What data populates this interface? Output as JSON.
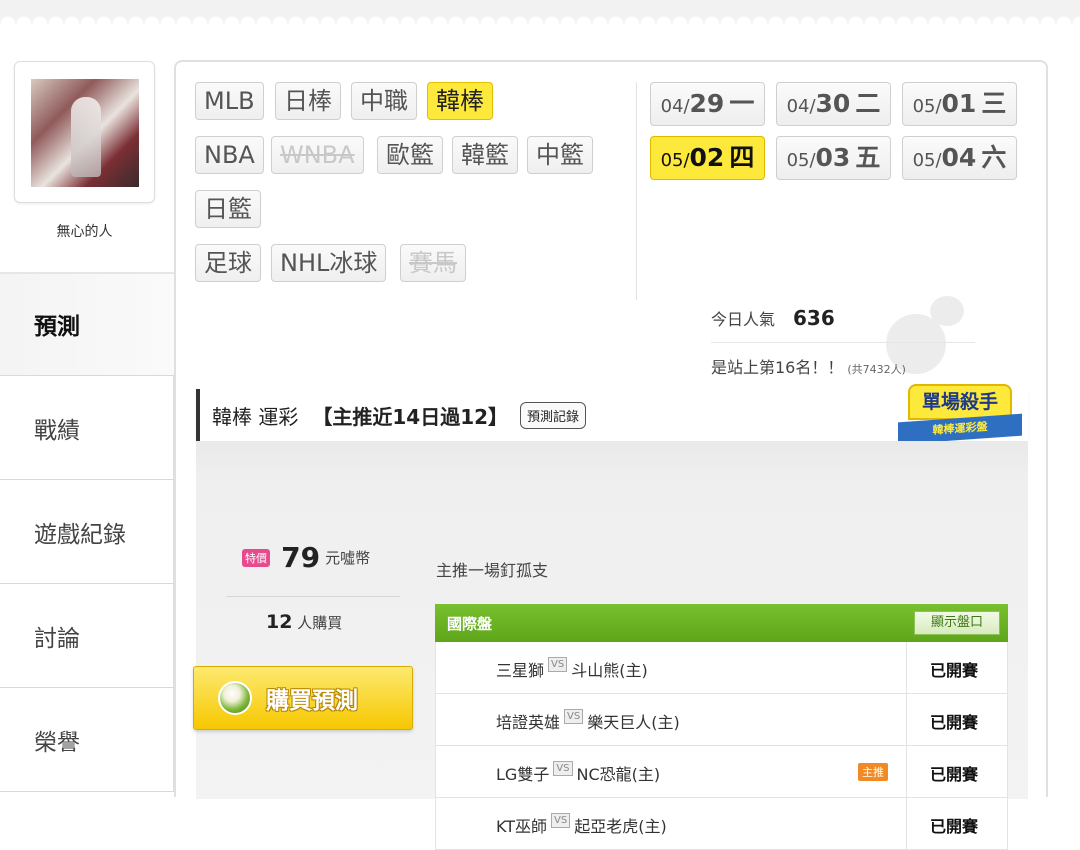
{
  "user": {
    "name": "無心的人"
  },
  "sidenav": [
    {
      "label": "預測"
    },
    {
      "label": "戰績"
    },
    {
      "label": "遊戲紀錄"
    },
    {
      "label": "討論"
    },
    {
      "label": "榮譽"
    }
  ],
  "sports": [
    {
      "label": "MLB"
    },
    {
      "label": "日棒"
    },
    {
      "label": "中職"
    },
    {
      "label": "韓棒"
    },
    {
      "label": "NBA"
    },
    {
      "label": "WNBA"
    },
    {
      "label": "歐籃"
    },
    {
      "label": "韓籃"
    },
    {
      "label": "中籃"
    },
    {
      "label": "日籃"
    },
    {
      "label": "足球"
    },
    {
      "label": "NHL冰球"
    },
    {
      "label": "賽馬"
    }
  ],
  "dates": [
    {
      "md": "04/",
      "d": "29",
      "wd": "一"
    },
    {
      "md": "04/",
      "d": "30",
      "wd": "二"
    },
    {
      "md": "05/",
      "d": "01",
      "wd": "三"
    },
    {
      "md": "05/",
      "d": "02",
      "wd": "四"
    },
    {
      "md": "05/",
      "d": "03",
      "wd": "五"
    },
    {
      "md": "05/",
      "d": "04",
      "wd": "六"
    }
  ],
  "popularity": {
    "label": "今日人氣",
    "value": "636",
    "rank_text": "是站上第16名！！",
    "total": "(共7432人)"
  },
  "header": {
    "sport": "韓棒",
    "type": "運彩",
    "streak": "【主推近14日過12】",
    "record_button": "預測記錄"
  },
  "badge": {
    "title": "單場殺手",
    "ribbon": "韓棒運彩盤"
  },
  "price": {
    "special": "特價",
    "amount": "79",
    "unit": "元噓幣",
    "buyers": "12",
    "buyers_unit": "人購買"
  },
  "buy_button": {
    "coin": "噓",
    "label": "購買預測"
  },
  "pick_text": "主推一場釘孤支",
  "table": {
    "title": "國際盤",
    "show_button": "顯示盤口",
    "vs": "VS",
    "main_tag": "主推",
    "rows": [
      {
        "away": "三星獅",
        "home": "斗山熊(主)",
        "status": "已開賽"
      },
      {
        "away": "培證英雄",
        "home": "樂天巨人(主)",
        "status": "已開賽"
      },
      {
        "away": "LG雙子",
        "home": "NC恐龍(主)",
        "status": "已開賽"
      },
      {
        "away": "KT巫師",
        "home": "起亞老虎(主)",
        "status": "已開賽"
      }
    ]
  },
  "colors": {
    "accent_yellow": "#fde93c",
    "table_green": "#6ab322",
    "special_pink": "#e74a8f",
    "main_tag_orange": "#f08a24"
  }
}
